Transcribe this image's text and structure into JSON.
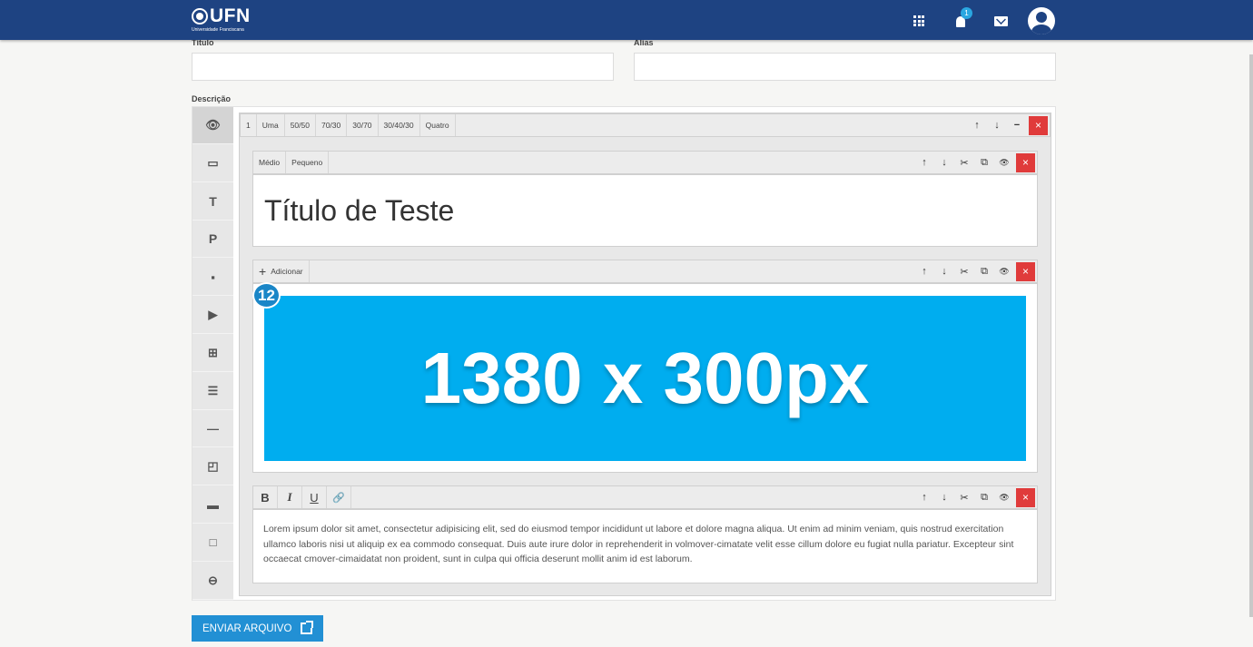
{
  "header": {
    "logo_text": "UFN",
    "logo_subtitle": "Universidade Franciscana",
    "notification_count": "1",
    "icons": [
      "apps-icon",
      "bell-icon",
      "mail-icon",
      "avatar-icon"
    ]
  },
  "form": {
    "title_label": "Título",
    "title_value": "",
    "alias_label": "Alias",
    "alias_value": "",
    "description_label": "Descrição"
  },
  "sidebar": {
    "items": [
      {
        "name": "preview",
        "icon": "eye-icon",
        "glyph": "👁",
        "active": true
      },
      {
        "name": "container",
        "icon": "window-icon",
        "glyph": "▭"
      },
      {
        "name": "title",
        "icon": "title-icon",
        "glyph": "T"
      },
      {
        "name": "paragraph",
        "icon": "paragraph-icon",
        "glyph": "P"
      },
      {
        "name": "image",
        "icon": "image-icon",
        "glyph": "▪"
      },
      {
        "name": "video",
        "icon": "play-icon",
        "glyph": "▶"
      },
      {
        "name": "table",
        "icon": "table-icon",
        "glyph": "⊞"
      },
      {
        "name": "list",
        "icon": "list-icon",
        "glyph": "☰"
      },
      {
        "name": "divider",
        "icon": "divider-icon",
        "glyph": "—"
      },
      {
        "name": "card",
        "icon": "card-icon",
        "glyph": "◰"
      },
      {
        "name": "band",
        "icon": "band-icon",
        "glyph": "▬"
      },
      {
        "name": "box",
        "icon": "box-icon",
        "glyph": "□"
      },
      {
        "name": "link",
        "icon": "link-icon",
        "glyph": "⊖"
      }
    ]
  },
  "row_toolbar": {
    "columns_count": "1",
    "layouts": [
      "Uma",
      "50/50",
      "70/30",
      "30/70",
      "30/40/30",
      "Quatro"
    ]
  },
  "heading_block": {
    "sizes": [
      "Médio",
      "Pequeno"
    ],
    "text": "Título de Teste"
  },
  "image_block": {
    "add_label": "Adicionar",
    "badge": "12",
    "placeholder_text": "1380 x 300px"
  },
  "text_block": {
    "format_buttons": [
      "B",
      "I",
      "U",
      "🔗"
    ],
    "text": "Lorem ipsum dolor sit amet, consectetur adipisicing elit, sed do eiusmod tempor incididunt ut labore et dolore magna aliqua. Ut enim ad minim veniam, quis nostrud exercitation ullamco laboris nisi ut aliquip ex ea commodo consequat. Duis aute irure dolor in reprehenderit in volmover-cimatate velit esse cillum dolore eu fugiat nulla pariatur. Excepteur sint occaecat cmover-cimaidatat non proident, sunt in culpa qui officia deserunt mollit anim id est laborum."
  },
  "block_actions": {
    "up": "↑",
    "down": "↓",
    "cut": "✂",
    "copy": "⧉",
    "preview": "👁",
    "close": "×",
    "minimize": "−"
  },
  "send_button": {
    "label": "ENVIAR ARQUIVO"
  },
  "colors": {
    "header": "#1e4382",
    "accent": "#2290d4",
    "danger": "#e03b3b",
    "banner": "#00adef"
  }
}
